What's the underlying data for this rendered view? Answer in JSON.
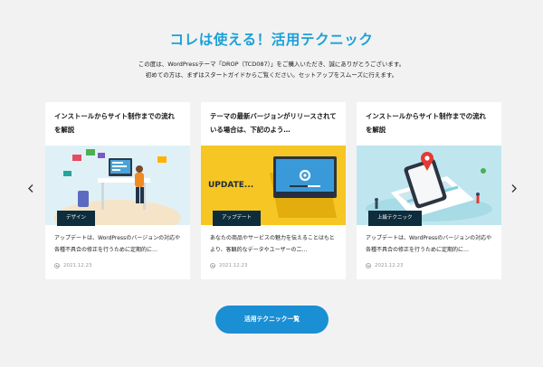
{
  "section": {
    "title": "コレは使える！活用テクニック",
    "intro_line1": "この度は、WordPressテーマ「DROP（TCD087）」をご購入いただき、誠にありがとうございます。",
    "intro_line2": "初めての方は、まずはスタートガイドからご覧ください。セットアップをスムーズに行えます。"
  },
  "carousel": {
    "prev_icon": "chevron-left-icon",
    "next_icon": "chevron-right-icon",
    "cards": [
      {
        "title": "インストールからサイト制作までの流れを解説",
        "category": "デザイン",
        "excerpt": "アップデートは、WordPressのバージョンの対応や各種不具合の修正を行うために定期的に…",
        "date": "2021.12.23"
      },
      {
        "title": "テーマの最新バージョンがリリースされている場合は、下記のよう…",
        "category": "アップデート",
        "image_text": "UPDATE...",
        "excerpt": "あなたの商品やサービスの魅力を伝えることはもとより、客観的なデータやユーザーの二…",
        "date": "2021.12.23"
      },
      {
        "title": "インストールからサイト制作までの流れを解説",
        "category": "上級テクニック",
        "excerpt": "アップデートは、WordPressのバージョンの対応や各種不具合の修正を行うために定期的に…",
        "date": "2021.12.23"
      }
    ]
  },
  "cta": {
    "label": "活用テクニック一覧"
  },
  "colors": {
    "accent": "#1ba0d7",
    "button": "#1a8fd4",
    "tag_bg": "#0d2d3c",
    "update_bg": "#f6c624"
  }
}
